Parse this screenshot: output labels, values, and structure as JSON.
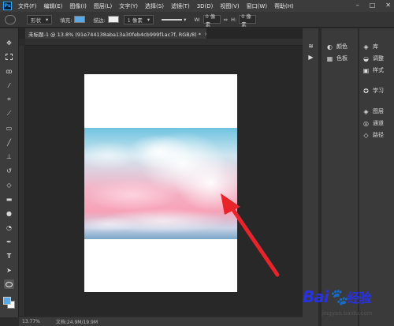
{
  "app": {
    "logo": "Ps"
  },
  "menu": [
    "文件(F)",
    "编辑(E)",
    "图像(I)",
    "图层(L)",
    "文字(Y)",
    "选择(S)",
    "滤镜(T)",
    "3D(D)",
    "视图(V)",
    "窗口(W)",
    "帮助(H)"
  ],
  "window_controls": {
    "minimize": "–",
    "maximize": "□",
    "close": "✕"
  },
  "options": {
    "tool_mode": "形状",
    "fill_label": "填充:",
    "fill_color": "#5aa9e6",
    "stroke_label": "描边:",
    "stroke_width": "1 像素",
    "w_label": "W:",
    "w_value": "0 像素",
    "link_symbol": "⇔",
    "h_label": "H:",
    "h_value": "0 像素"
  },
  "document_tab": {
    "title": "未标题-1 @ 13.8% (91e744138aba13a30feb4cb999f1ac7f, RGB/8) *",
    "close": "×"
  },
  "status": {
    "zoom": "13.77%",
    "doc_size": "文档:24.9M/19.9M"
  },
  "panels": {
    "color": "颜色",
    "swatches": "色板",
    "library": "库",
    "adjustments": "调整",
    "styles": "样式",
    "learn": "学习",
    "layers": "图层",
    "channels": "通道",
    "paths": "路径"
  },
  "colors": {
    "accent": "#31a8ff",
    "arrow": "#e8232a",
    "baidu_blue": "#2932e1",
    "baidu_red": "#e10602"
  },
  "watermark": {
    "brand": "Bai",
    "brand_tail": "经验",
    "url": "jingyan.baidu.com"
  }
}
